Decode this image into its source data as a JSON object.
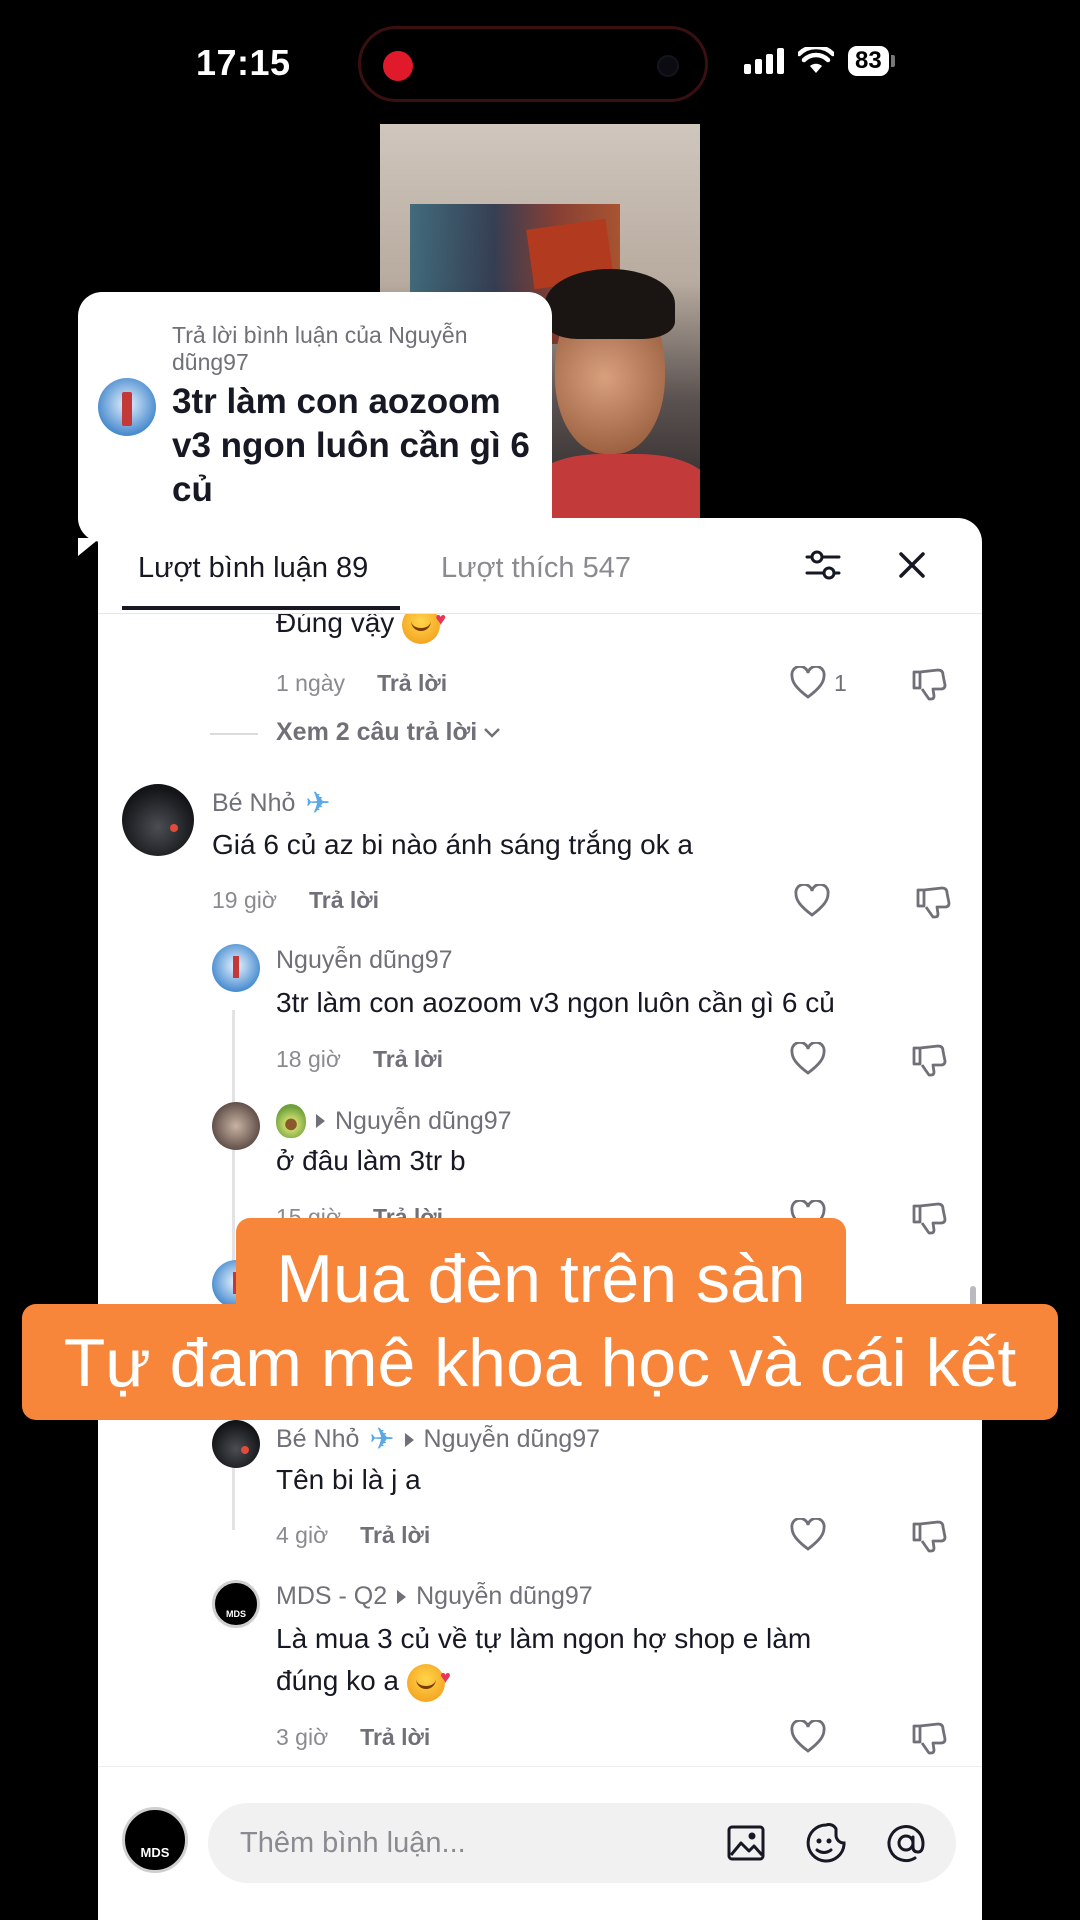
{
  "status_bar": {
    "time": "17:15",
    "battery": "83",
    "icons": [
      "recording-dot-icon",
      "signal-icon",
      "wifi-icon",
      "battery-icon"
    ]
  },
  "reply_bubble": {
    "header": "Trả lời bình luận của Nguyễn dũng97",
    "text": "3tr làm con aozoom v3 ngon luôn cần gì 6 củ"
  },
  "tabs": {
    "comments": "Lượt bình luận 89",
    "likes": "Lượt thích 547"
  },
  "comments": {
    "first": {
      "text": "Đúng vậy",
      "time": "1 ngày",
      "reply": "Trả lời",
      "likes": "1"
    },
    "view_more": "Xem 2 câu trả lời",
    "be_nho": {
      "user": "Bé Nhỏ",
      "text": "Giá 6 củ az bi nào ánh sáng trắng ok a",
      "time": "19 giờ",
      "reply": "Trả lời"
    },
    "nguyen": {
      "user": "Nguyễn dũng97",
      "text": "3tr làm con aozoom v3 ngon luôn cần gì 6 củ",
      "time": "18 giờ",
      "reply": "Trả lời"
    },
    "avocado": {
      "user_target": "Nguyễn dũng97",
      "text": "ở đâu làm 3tr b",
      "time": "15 giờ",
      "reply": "Trả lời"
    },
    "be_nho_reply": {
      "user": "Bé Nhỏ",
      "user_target": "Nguyễn dũng97",
      "text": "Tên bi là j a",
      "time": "4 giờ",
      "reply": "Trả lời"
    },
    "mds": {
      "user": "MDS - Q2",
      "user_target": "Nguyễn dũng97",
      "text": "Là mua 3 củ về tự làm ngon hợ shop e làm đúng ko a",
      "time": "3 giờ",
      "reply": "Trả lời"
    }
  },
  "caption": {
    "line1": "Mua đèn trên sàn",
    "line2": "Tự đam mê khoa học và cái kết",
    "color": "#f7853a"
  },
  "input": {
    "placeholder": "Thêm bình luận...",
    "avatar_text": "MDS"
  }
}
